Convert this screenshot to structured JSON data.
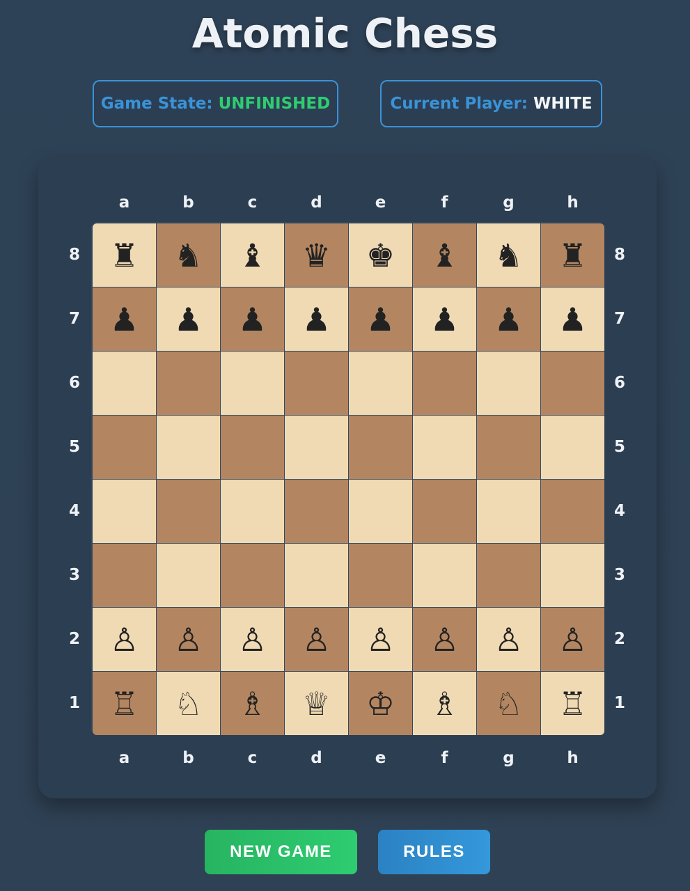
{
  "title": "Atomic Chess",
  "status": {
    "game_state_label": "Game State:",
    "game_state_value": "UNFINISHED",
    "current_player_label": "Current Player:",
    "current_player_value": "WHITE"
  },
  "files": [
    "a",
    "b",
    "c",
    "d",
    "e",
    "f",
    "g",
    "h"
  ],
  "ranks": [
    "8",
    "7",
    "6",
    "5",
    "4",
    "3",
    "2",
    "1"
  ],
  "board": [
    [
      "♜",
      "♞",
      "♝",
      "♛",
      "♚",
      "♝",
      "♞",
      "♜"
    ],
    [
      "♟",
      "♟",
      "♟",
      "♟",
      "♟",
      "♟",
      "♟",
      "♟"
    ],
    [
      "",
      "",
      "",
      "",
      "",
      "",
      "",
      ""
    ],
    [
      "",
      "",
      "",
      "",
      "",
      "",
      "",
      ""
    ],
    [
      "",
      "",
      "",
      "",
      "",
      "",
      "",
      ""
    ],
    [
      "",
      "",
      "",
      "",
      "",
      "",
      "",
      ""
    ],
    [
      "♙",
      "♙",
      "♙",
      "♙",
      "♙",
      "♙",
      "♙",
      "♙"
    ],
    [
      "♖",
      "♘",
      "♗",
      "♕",
      "♔",
      "♗",
      "♘",
      "♖"
    ]
  ],
  "buttons": {
    "new_game": "NEW GAME",
    "rules": "RULES"
  },
  "colors": {
    "light_square": "#f0dab4",
    "dark_square": "#b38661",
    "accent_blue": "#3a93d8",
    "accent_green": "#2fcc71"
  }
}
